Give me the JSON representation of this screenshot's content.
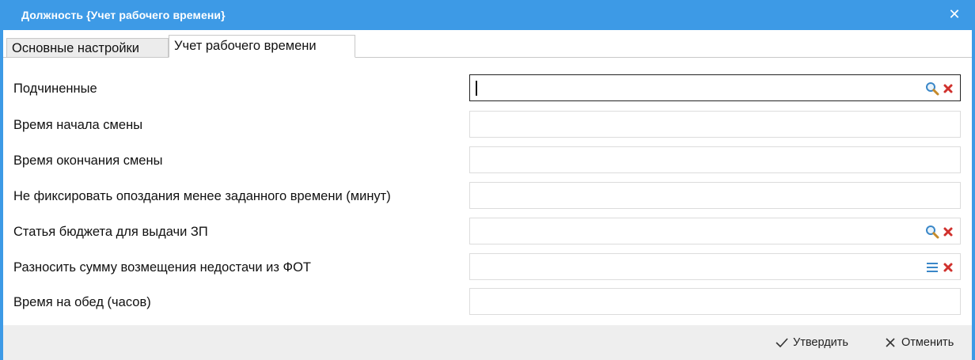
{
  "window": {
    "title": "Должность {Учет рабочего времени}",
    "close_icon": "close-icon"
  },
  "tabs": [
    {
      "label": "Основные настройки",
      "active": false
    },
    {
      "label": "Учет рабочего времени",
      "active": true
    }
  ],
  "fields": [
    {
      "label": "Подчиненные",
      "value": "",
      "buttons": [
        "search-icon",
        "clear-icon"
      ],
      "focused": true
    },
    {
      "label": "Время начала смены",
      "value": "",
      "buttons": []
    },
    {
      "label": "Время окончания смены",
      "value": "",
      "buttons": []
    },
    {
      "label": "Не фиксировать опоздания менее заданного времени (минут)",
      "value": "",
      "buttons": []
    },
    {
      "label": "Статья бюджета для выдачи ЗП",
      "value": "",
      "buttons": [
        "search-icon",
        "clear-icon"
      ]
    },
    {
      "label": "Разносить сумму возмещения недостачи из ФОТ",
      "value": "",
      "buttons": [
        "list-icon",
        "clear-icon"
      ]
    },
    {
      "label": "Время на обед (часов)",
      "value": "",
      "buttons": []
    }
  ],
  "footer": {
    "confirm_label": "Утвердить",
    "cancel_label": "Отменить"
  },
  "colors": {
    "accent": "#3d9ae6",
    "clear_icon": "#d0312d",
    "search_icon": "#3a87c8",
    "footer_bg": "#eeeeee"
  }
}
